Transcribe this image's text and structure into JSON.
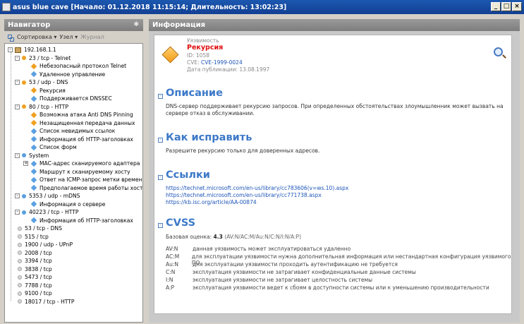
{
  "window": {
    "title": "asus blue cave [Начало: 01.12.2018 11:15:14; Длительность: 13:02:23]",
    "minimize": "_",
    "maximize": "□",
    "close": "×"
  },
  "navigator": {
    "title": "Навигатор",
    "toolbar": {
      "sort": "Сортировка ▾",
      "node": "Узел ▾",
      "log": "Журнал"
    },
    "root": "192.168.1.1",
    "tree": [
      {
        "label": "23 / tcp - Telnet",
        "level": 1,
        "type": "service",
        "color": "#f0a020",
        "expander": "-"
      },
      {
        "label": "Небезопасный протокол Telnet",
        "level": 2,
        "type": "vuln",
        "color": "#f0a020"
      },
      {
        "label": "Удаленное управление",
        "level": 2,
        "type": "vuln",
        "color": "#5aa0e0"
      },
      {
        "label": "53 / udp - DNS",
        "level": 1,
        "type": "service",
        "color": "#f0a020",
        "expander": "-"
      },
      {
        "label": "Рекурсия",
        "level": 2,
        "type": "vuln",
        "color": "#f0a020"
      },
      {
        "label": "Поддерживается DNSSEC",
        "level": 2,
        "type": "vuln",
        "color": "#5aa0e0"
      },
      {
        "label": "80 / tcp - HTTP",
        "level": 1,
        "type": "service",
        "color": "#f0a020",
        "expander": "-"
      },
      {
        "label": "Возможна атака Anti DNS Pinning",
        "level": 2,
        "type": "vuln",
        "color": "#f0a020"
      },
      {
        "label": "Незащищенная передача данных",
        "level": 2,
        "type": "vuln",
        "color": "#f0a020"
      },
      {
        "label": "Список невидимых ссылок",
        "level": 2,
        "type": "vuln",
        "color": "#5aa0e0"
      },
      {
        "label": "Информация об HTTP-заголовках",
        "level": 2,
        "type": "vuln",
        "color": "#5aa0e0"
      },
      {
        "label": "Список форм",
        "level": 2,
        "type": "vuln",
        "color": "#5aa0e0"
      },
      {
        "label": "System",
        "level": 1,
        "type": "service",
        "color": "#5aa0e0",
        "expander": "-"
      },
      {
        "label": "MAC-адрес сканируемого адаптера",
        "level": 2,
        "type": "vuln",
        "color": "#5aa0e0",
        "expander": "+"
      },
      {
        "label": "Маршрут к сканируемому хосту",
        "level": 2,
        "type": "vuln",
        "color": "#5aa0e0"
      },
      {
        "label": "Ответ на ICMP-запрос метки времени",
        "level": 2,
        "type": "vuln",
        "color": "#5aa0e0"
      },
      {
        "label": "Предполагаемое время работы хоста п",
        "level": 2,
        "type": "vuln",
        "color": "#5aa0e0"
      },
      {
        "label": "5353 / udp - mDNS",
        "level": 1,
        "type": "service",
        "color": "#5aa0e0",
        "expander": "-"
      },
      {
        "label": "Информация о сервере",
        "level": 2,
        "type": "vuln",
        "color": "#5aa0e0"
      },
      {
        "label": "40223 / tcp - HTTP",
        "level": 1,
        "type": "service",
        "color": "#5aa0e0",
        "expander": "-"
      },
      {
        "label": "Информация об HTTP-заголовках",
        "level": 2,
        "type": "vuln",
        "color": "#5aa0e0"
      },
      {
        "label": "53 / tcp - DNS",
        "level": 1,
        "type": "port",
        "color": "#d8d8d8"
      },
      {
        "label": "515 / tcp",
        "level": 1,
        "type": "port",
        "color": "#d8d8d8"
      },
      {
        "label": "1900 / udp - UPnP",
        "level": 1,
        "type": "port",
        "color": "#d8d8d8"
      },
      {
        "label": "2008 / tcp",
        "level": 1,
        "type": "port",
        "color": "#d8d8d8"
      },
      {
        "label": "3394 / tcp",
        "level": 1,
        "type": "port",
        "color": "#d8d8d8"
      },
      {
        "label": "3838 / tcp",
        "level": 1,
        "type": "port",
        "color": "#d8d8d8"
      },
      {
        "label": "5473 / tcp",
        "level": 1,
        "type": "port",
        "color": "#d8d8d8"
      },
      {
        "label": "7788 / tcp",
        "level": 1,
        "type": "port",
        "color": "#d8d8d8"
      },
      {
        "label": "9100 / tcp",
        "level": 1,
        "type": "port",
        "color": "#d8d8d8"
      },
      {
        "label": "18017 / tcp - HTTP",
        "level": 1,
        "type": "port",
        "color": "#d8d8d8"
      }
    ]
  },
  "info": {
    "title": "Информация",
    "header": {
      "category": "Уязвимость",
      "name": "Рекурсия",
      "id": "ID: 1058",
      "cve_prefix": "CVE:",
      "cve": "CVE-1999-0024",
      "published": "Дата публикации: 13.08.1997"
    },
    "description": {
      "title": "Описание",
      "text": "DNS-сервер поддерживает рекурсию запросов. При определенных обстоятельствах злоумышленник может вызвать на сервере отказ в обслуживании."
    },
    "fix": {
      "title": "Как исправить",
      "text": "Разрешите рекурсию только для доверенных адресов."
    },
    "links": {
      "title": "Ссылки",
      "items": [
        "https://technet.microsoft.com/en-us/library/cc783606(v=ws.10).aspx",
        "https://technet.microsoft.com/en-us/library/cc771738.aspx",
        "https://kb.isc.org/article/AA-00874"
      ]
    },
    "cvss": {
      "title": "CVSS",
      "score_label": "Базовая оценка:",
      "score": "4.3",
      "vector": "(AV:N/AC:M/Au:N/C:N/I:N/A:P)",
      "rows": [
        {
          "code": "AV:N",
          "text": "данная уязвимость может эксплуатироваться удаленно"
        },
        {
          "code": "AC:M",
          "text": "для эксплуатации уязвимости нужна дополнительная информация или нестандартная конфигурация уязвимого ПО"
        },
        {
          "code": "Au:N",
          "text": "для эксплуатации уязвимости проходить аутентификацию не требуется"
        },
        {
          "code": "C:N",
          "text": "эксплуатация уязвимости не затрагивает конфиденциальные данные системы"
        },
        {
          "code": "I:N",
          "text": "эксплуатация уязвимости не затрагивает целостность системы"
        },
        {
          "code": "A:P",
          "text": "эксплуатация уязвимости ведет к сбоям в доступности системы или к уменьшению производительности"
        }
      ]
    }
  }
}
